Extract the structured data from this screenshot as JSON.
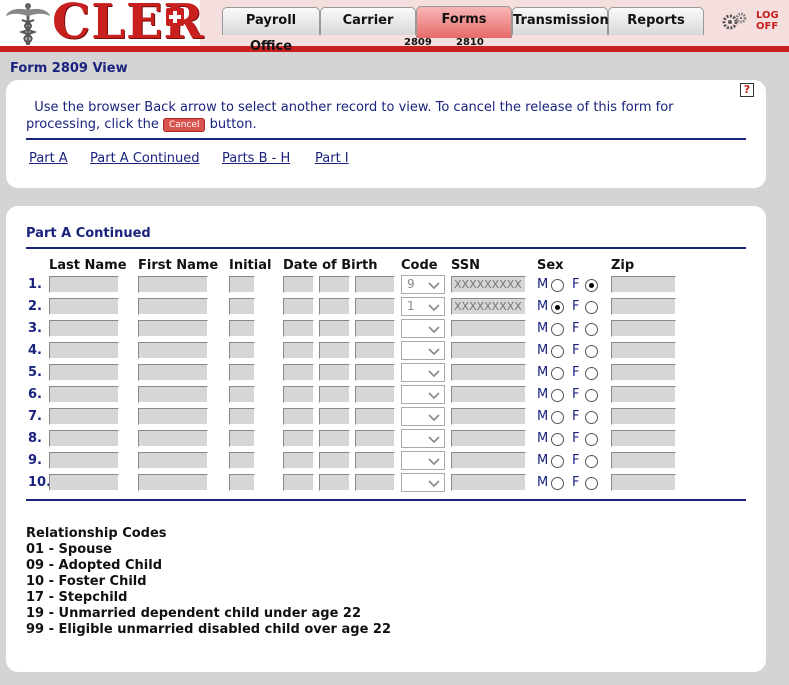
{
  "header": {
    "logo_text": "CLER",
    "tabs": [
      {
        "label": "Payroll Office"
      },
      {
        "label": "Carrier"
      },
      {
        "label": "Forms"
      },
      {
        "label": "Transmission"
      },
      {
        "label": "Reports"
      }
    ],
    "subtabs": [
      "2809",
      "2810"
    ],
    "logoff_line1": "LOG",
    "logoff_line2": "OFF"
  },
  "page": {
    "title": "Form 2809 View",
    "help_icon": "?",
    "instruction_before": "Use the browser Back arrow to select another record to view.  To cancel the release of this form for processing, click the ",
    "cancel_button": "Cancel",
    "instruction_after": " button.",
    "nav_links": [
      "Part A",
      "Part A Continued",
      "Parts B - H",
      "Part I"
    ]
  },
  "section": {
    "title": "Part A Continued",
    "columns": {
      "last_name": "Last Name",
      "first_name": "First Name",
      "initial": "Initial",
      "dob": "Date of Birth",
      "code": "Code",
      "ssn": "SSN",
      "sex": "Sex",
      "zip": "Zip"
    },
    "sex_m": "M",
    "sex_f": "F",
    "rows": [
      {
        "num": "1.",
        "code": "9",
        "ssn": "XXXXXXXXX",
        "sex": "F"
      },
      {
        "num": "2.",
        "code": "1",
        "ssn": "XXXXXXXXX",
        "sex": "M"
      },
      {
        "num": "3.",
        "code": "",
        "ssn": "",
        "sex": ""
      },
      {
        "num": "4.",
        "code": "",
        "ssn": "",
        "sex": ""
      },
      {
        "num": "5.",
        "code": "",
        "ssn": "",
        "sex": ""
      },
      {
        "num": "6.",
        "code": "",
        "ssn": "",
        "sex": ""
      },
      {
        "num": "7.",
        "code": "",
        "ssn": "",
        "sex": ""
      },
      {
        "num": "8.",
        "code": "",
        "ssn": "",
        "sex": ""
      },
      {
        "num": "9.",
        "code": "",
        "ssn": "",
        "sex": ""
      },
      {
        "num": "10.",
        "code": "",
        "ssn": "",
        "sex": ""
      }
    ]
  },
  "relationship_codes": {
    "title": "Relationship Codes",
    "items": [
      "01 - Spouse",
      "09 - Adopted Child",
      "10 - Foster Child",
      "17 - Stepchild",
      "19 - Unmarried dependent child under age 22",
      "99 - Eligible unmarried disabled child over age 22"
    ]
  },
  "colors": {
    "brand_red": "#c8201e",
    "navy": "#1a237e",
    "field_gray": "#d6d6d6",
    "page_gray": "#d4d4d4"
  }
}
